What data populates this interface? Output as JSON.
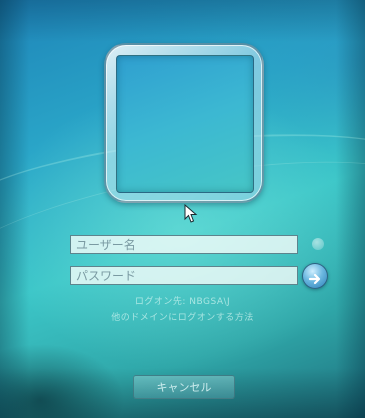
{
  "logon": {
    "username_placeholder": "ユーザー名",
    "password_placeholder": "パスワード",
    "message_line_1": "ログオン先: NBGSA\\J",
    "message_line_2": "他のドメインにログオンする方法",
    "cancel_label": "キャンセル"
  },
  "icons": {
    "submit": "arrow-right-icon",
    "cursor": "mouse-pointer-icon"
  },
  "colors": {
    "background": "#2aa6c8",
    "submit_button": "#2c7fb8"
  }
}
